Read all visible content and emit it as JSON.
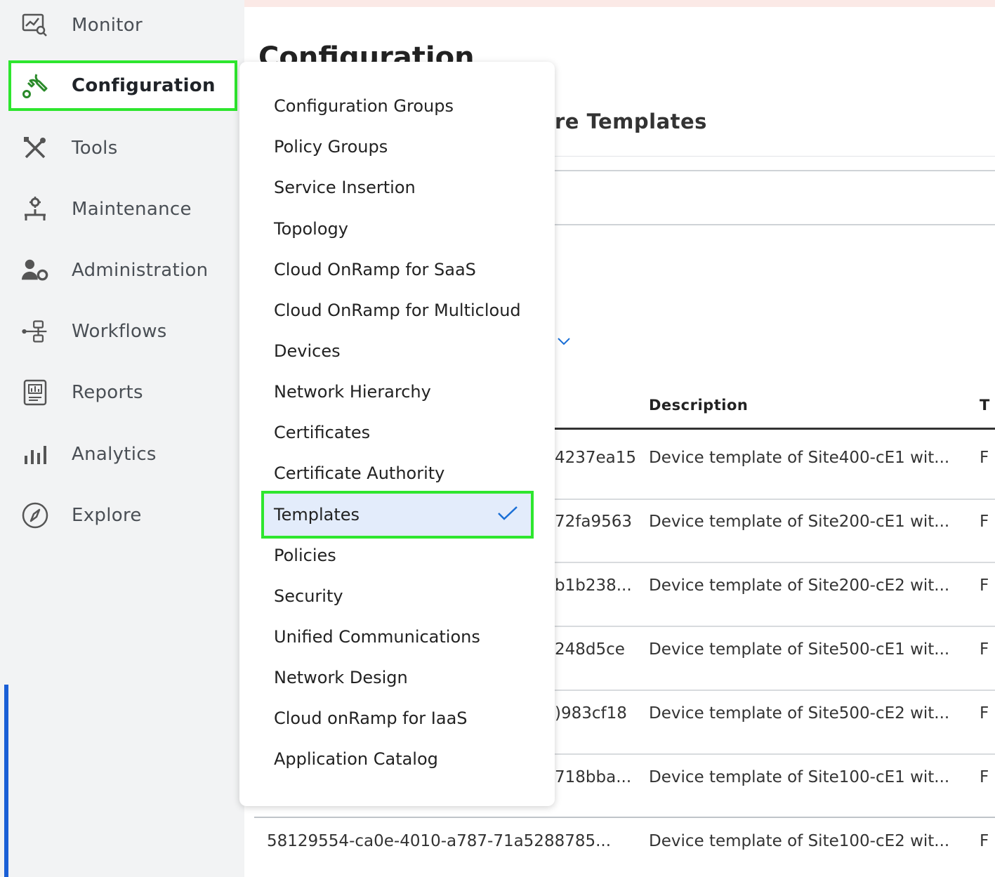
{
  "sidebar": {
    "items": [
      {
        "label": "Monitor",
        "icon": "monitor-icon"
      },
      {
        "label": "Configuration",
        "icon": "wrench-icon",
        "active": true
      },
      {
        "label": "Tools",
        "icon": "tools-icon"
      },
      {
        "label": "Maintenance",
        "icon": "maintenance-icon"
      },
      {
        "label": "Administration",
        "icon": "admin-icon"
      },
      {
        "label": "Workflows",
        "icon": "workflows-icon"
      },
      {
        "label": "Reports",
        "icon": "reports-icon"
      },
      {
        "label": "Analytics",
        "icon": "analytics-icon"
      },
      {
        "label": "Explore",
        "icon": "compass-icon"
      }
    ]
  },
  "main": {
    "title": "Configuration",
    "subtitle": "re Templates",
    "table": {
      "headers": {
        "description": "Description",
        "next": "T"
      },
      "rows": [
        {
          "id": "4237ea15",
          "description": "Device template of Site400-cE1 wit...",
          "next": "F"
        },
        {
          "id": "72fa9563",
          "description": "Device template of Site200-cE1 wit...",
          "next": "F"
        },
        {
          "id": "b1b238...",
          "description": "Device template of Site200-cE2 wit...",
          "next": "F"
        },
        {
          "id": "248d5ce",
          "description": "Device template of Site500-cE1 wit...",
          "next": "F"
        },
        {
          "id": ")983cf18",
          "description": "Device template of Site500-cE2 wit...",
          "next": "F"
        },
        {
          "id": "718bba...",
          "description": "Device template of Site100-cE1 wit...",
          "next": "F"
        },
        {
          "id": "58129554-ca0e-4010-a787-71a5288785...",
          "description": "Device template of Site100-cE2 wit...",
          "next": "F"
        }
      ]
    }
  },
  "dropdown": {
    "items": [
      "Configuration Groups",
      "Policy Groups",
      "Service Insertion",
      "Topology",
      "Cloud OnRamp for SaaS",
      "Cloud OnRamp for Multicloud",
      "Devices",
      "Network Hierarchy",
      "Certificates",
      "Certificate Authority",
      "Templates",
      "Policies",
      "Security",
      "Unified Communications",
      "Network Design",
      "Cloud onRamp for IaaS",
      "Application Catalog"
    ],
    "selected": "Templates"
  },
  "colors": {
    "highlight_border": "#2ee62e",
    "selected_bg": "#e3ecfb",
    "check": "#1a6fd6",
    "active_icon": "#2a8a2a",
    "accent": "#1a5fd6"
  }
}
